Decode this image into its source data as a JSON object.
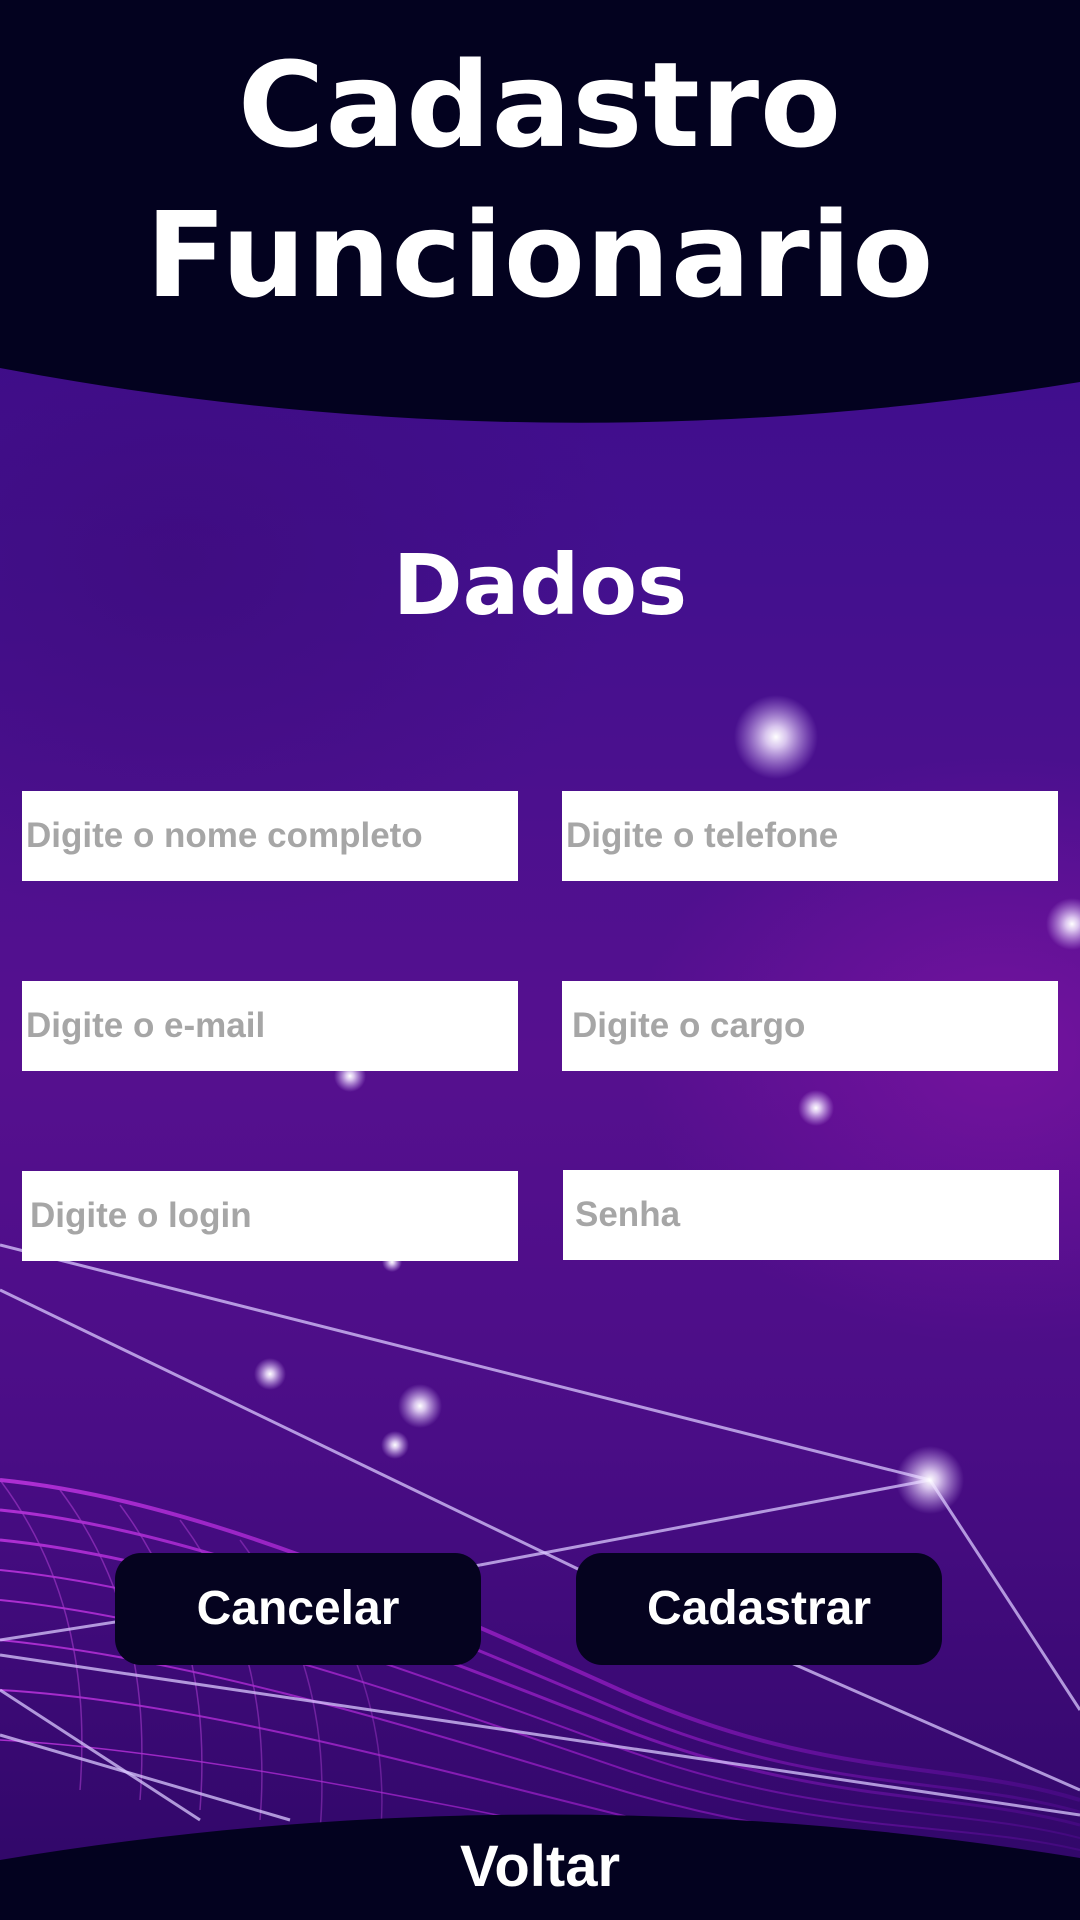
{
  "header": {
    "title_line_1": "Cadastro",
    "title_line_2": "Funcionario"
  },
  "section": {
    "title": "Dados"
  },
  "form": {
    "fields": [
      {
        "placeholder": "Digite o nome completo",
        "value": ""
      },
      {
        "placeholder": "Digite o telefone",
        "value": ""
      },
      {
        "placeholder": "Digite o e-mail",
        "value": ""
      },
      {
        "placeholder": "Digite o cargo",
        "value": ""
      },
      {
        "placeholder": "Digite o login",
        "value": ""
      },
      {
        "placeholder": "Senha",
        "value": ""
      }
    ]
  },
  "actions": {
    "cancel_label": "Cancelar",
    "submit_label": "Cadastrar"
  },
  "footer": {
    "back_label": "Voltar"
  },
  "colors": {
    "header_band": "#03021f",
    "background_purple": "#4a0d86",
    "accent_magenta": "#c026d3",
    "button_bg": "#05031f",
    "placeholder_gray": "#a6a6a6"
  }
}
